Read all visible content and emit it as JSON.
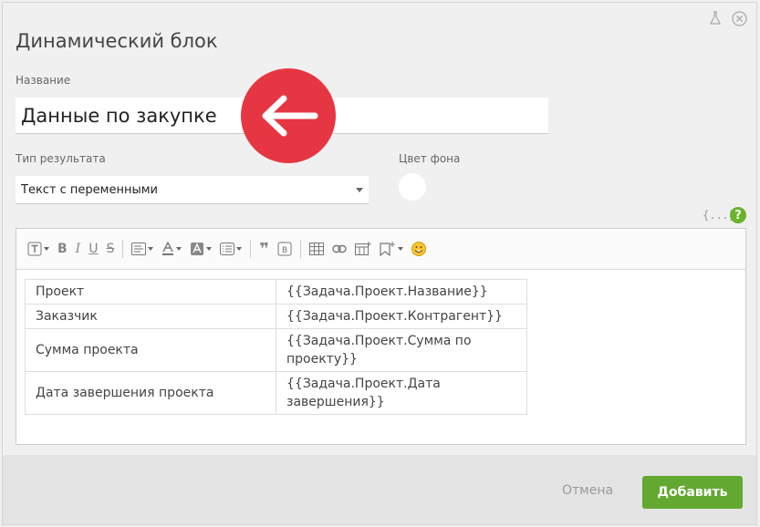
{
  "dialog": {
    "title": "Динамический блок",
    "name_label": "Название",
    "name_value": "Данные по закупке",
    "result_type_label": "Тип результата",
    "result_type_value": "Текст с переменными",
    "bg_color_label": "Цвет фона",
    "bg_color": "#ffffff",
    "var_icon_text": "{...}",
    "help_text": "?"
  },
  "header_icons": [
    "flask-icon",
    "close-circle-icon"
  ],
  "toolbar": {
    "items": [
      "text-style-icon",
      "bold-icon",
      "italic-icon",
      "underline-icon",
      "strikethrough-icon",
      "align-icon",
      "font-color-icon",
      "highlight-icon",
      "list-icon",
      "quote-icon",
      "template-icon",
      "table-icon",
      "link-icon",
      "insert-block-icon",
      "bookmark-icon",
      "emoji-icon"
    ]
  },
  "table": {
    "rows": [
      {
        "label": "Проект",
        "value": "{{Задача.Проект.Название}}"
      },
      {
        "label": "Заказчик",
        "value": "{{Задача.Проект.Контрагент}}"
      },
      {
        "label": "Сумма проекта",
        "value": "{{Задача.Проект.Сумма по проекту}}"
      },
      {
        "label": "Дата завершения проекта",
        "value": "{{Задача.Проект.Дата завершения}}"
      }
    ]
  },
  "footer": {
    "cancel_label": "Отмена",
    "add_label": "Добавить"
  },
  "colors": {
    "accent_green": "#63a831",
    "arrow_red": "#e73643"
  }
}
